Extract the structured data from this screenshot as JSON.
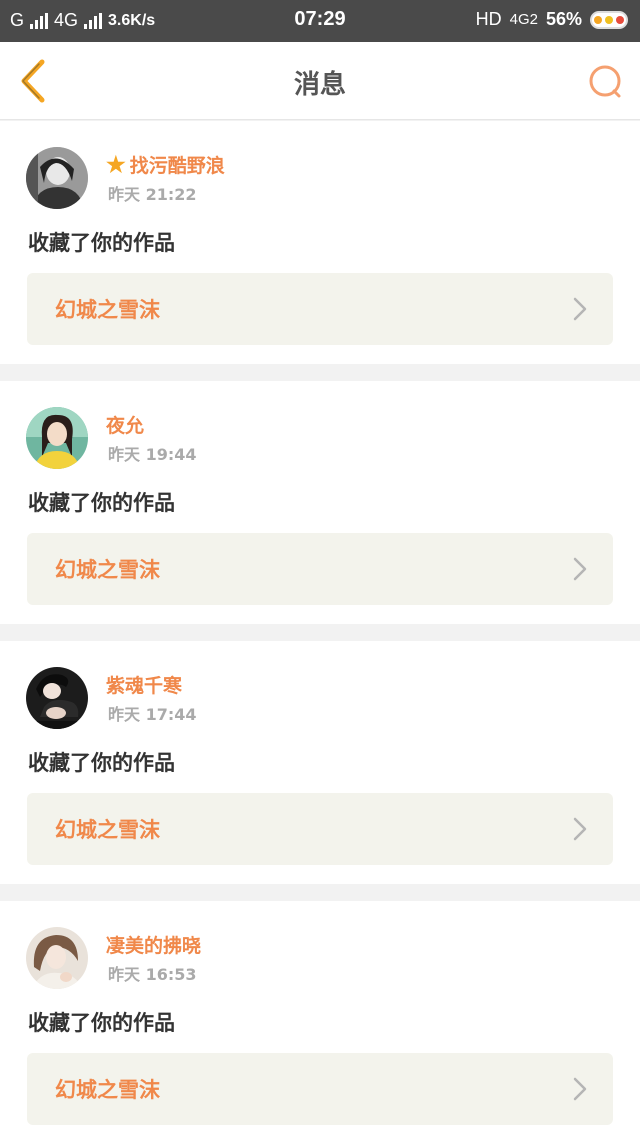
{
  "status_bar": {
    "left_text": "G",
    "network": "4G",
    "speed": "3.6K/s",
    "time": "07:29",
    "hd": "HD",
    "network_right": "4G2",
    "battery": "56%"
  },
  "header": {
    "title": "消息",
    "back_icon": "chevron-left-icon",
    "search_icon": "search-icon",
    "accent_color": "#f5a623"
  },
  "colors": {
    "accent": "#f0884a",
    "card_box": "#f3f3ec",
    "background": "#f2f2f2"
  },
  "messages": [
    {
      "name": "找污酷野浪",
      "vip_star": true,
      "time": "昨天 21:22",
      "action": "收藏了你的作品",
      "work_title": "幻城之雪沫"
    },
    {
      "name": "夜允",
      "vip_star": false,
      "time": "昨天 19:44",
      "action": "收藏了你的作品",
      "work_title": "幻城之雪沫"
    },
    {
      "name": "紫魂千寒",
      "vip_star": false,
      "time": "昨天 17:44",
      "action": "收藏了你的作品",
      "work_title": "幻城之雪沫"
    },
    {
      "name": "凄美的拂晓",
      "vip_star": false,
      "time": "昨天 16:53",
      "action": "收藏了你的作品",
      "work_title": "幻城之雪沫"
    }
  ]
}
